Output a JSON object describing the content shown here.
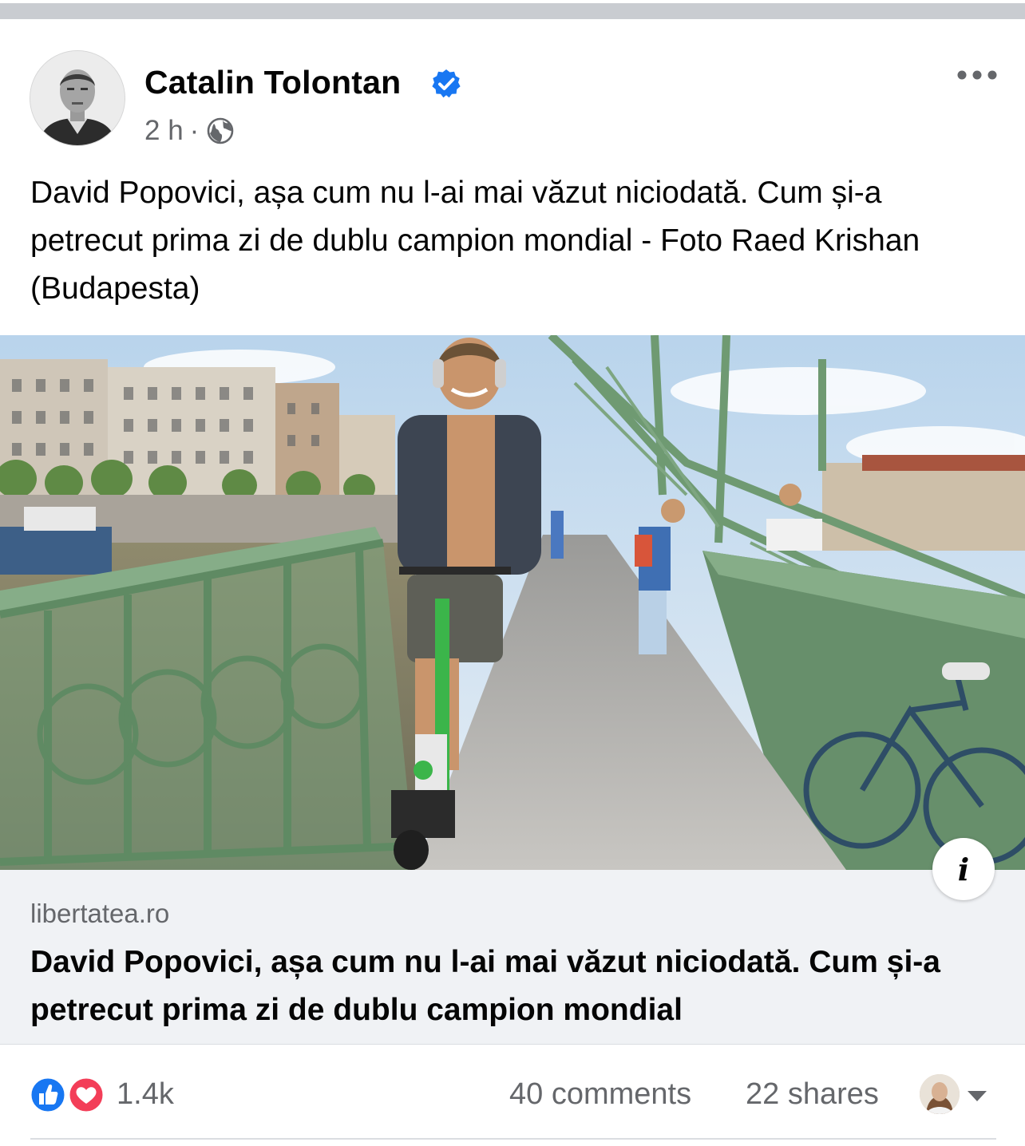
{
  "author": {
    "name": "Catalin Tolontan",
    "verified": true,
    "time": "2 h",
    "separator": "·",
    "audience_icon": "globe-icon"
  },
  "post": {
    "text": "David Popovici, așa cum nu l-ai mai văzut niciodată. Cum și-a petrecut prima zi de dublu campion mondial - Foto Raed Krishan (Budapesta)"
  },
  "link_preview": {
    "domain": "libertatea.ro",
    "title": "David Popovici, așa cum nu l-ai mai văzut niciodată. Cum și-a petrecut prima zi de dublu campion mondial",
    "info_icon": "info-icon"
  },
  "engagement": {
    "reactions": [
      "like",
      "love"
    ],
    "reaction_count": "1.4k",
    "comments": "40 comments",
    "shares": "22 shares"
  },
  "colors": {
    "verified_blue": "#1877f2",
    "like_blue": "#1877f2",
    "love_red": "#f33e58",
    "secondary_text": "#65676b",
    "bridge_green": "#6f9a72",
    "link_card_bg": "#f0f2f5"
  }
}
